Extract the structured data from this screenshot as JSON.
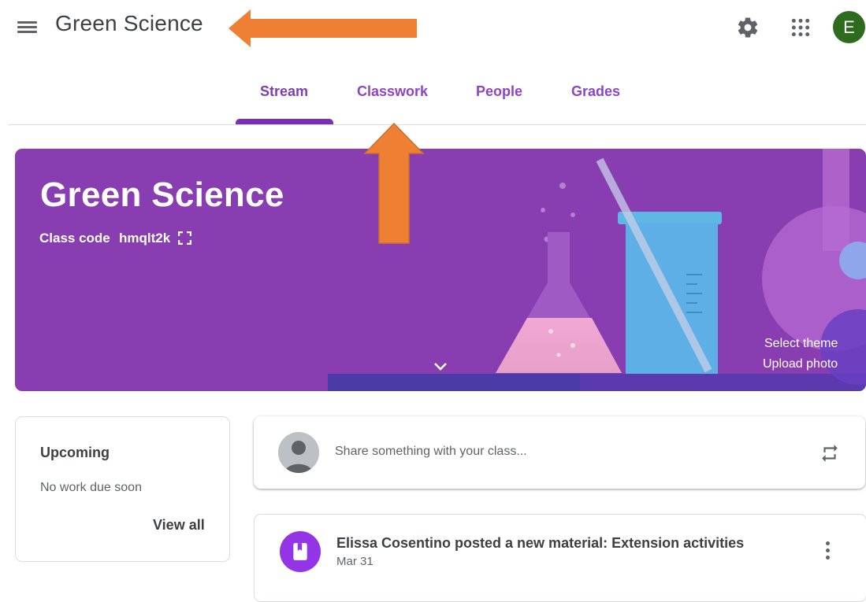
{
  "header": {
    "title": "Green Science",
    "avatar_letter": "E",
    "avatar_color": "#2e6b1f",
    "icons": [
      "menu-icon",
      "gear-icon",
      "apps-grid-icon"
    ]
  },
  "tabs": [
    {
      "label": "Stream",
      "active": true
    },
    {
      "label": "Classwork",
      "active": false
    },
    {
      "label": "People",
      "active": false
    },
    {
      "label": "Grades",
      "active": false
    }
  ],
  "banner": {
    "class_name": "Green Science",
    "class_code_label": "Class code",
    "class_code": "hmqlt2k",
    "select_theme": "Select theme",
    "upload_photo": "Upload photo",
    "color": "#883db0"
  },
  "upcoming": {
    "title": "Upcoming",
    "empty_text": "No work due soon",
    "view_all": "View all"
  },
  "share": {
    "placeholder": "Share something with your class..."
  },
  "posts": [
    {
      "title": "Elissa Cosentino posted a new material: Extension activities",
      "date": "Mar 31",
      "icon": "material-book-icon"
    }
  ],
  "annotations": {
    "arrow_color": "#ee7f33"
  }
}
